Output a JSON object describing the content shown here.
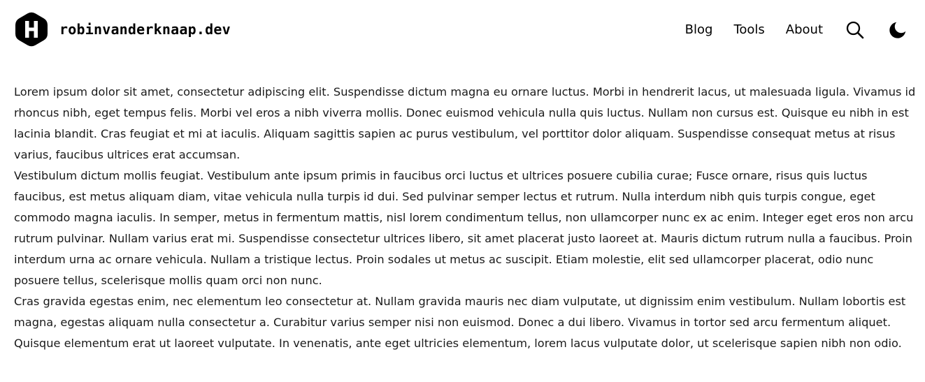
{
  "header": {
    "site_name": "robinvanderknaap.dev",
    "logo_icon": "hexagon-h-logo-icon",
    "nav": [
      {
        "label": "Blog"
      },
      {
        "label": "Tools"
      },
      {
        "label": "About"
      }
    ],
    "search_icon": "search-icon",
    "theme_toggle_icon": "moon-icon"
  },
  "content": {
    "paragraphs": [
      "Lorem ipsum dolor sit amet, consectetur adipiscing elit. Suspendisse dictum magna eu ornare luctus. Morbi in hendrerit lacus, ut malesuada ligula. Vivamus id rhoncus nibh, eget tempus felis. Morbi vel eros a nibh viverra mollis. Donec euismod vehicula nulla quis luctus. Nullam non cursus est. Quisque eu nibh in est lacinia blandit. Cras feugiat et mi at iaculis. Aliquam sagittis sapien ac purus vestibulum, vel porttitor dolor aliquam. Suspendisse consequat metus at risus varius, faucibus ultrices erat accumsan.",
      "Vestibulum dictum mollis feugiat. Vestibulum ante ipsum primis in faucibus orci luctus et ultrices posuere cubilia curae; Fusce ornare, risus quis luctus faucibus, est metus aliquam diam, vitae vehicula nulla turpis id dui. Sed pulvinar semper lectus et rutrum. Nulla interdum nibh quis turpis congue, eget commodo magna iaculis. In semper, metus in fermentum mattis, nisl lorem condimentum tellus, non ullamcorper nunc ex ac enim. Integer eget eros non arcu rutrum pulvinar. Nullam varius erat mi. Suspendisse consectetur ultrices libero, sit amet placerat justo laoreet at. Mauris dictum rutrum nulla a faucibus. Proin interdum urna ac ornare vehicula. Nullam a tristique lectus. Proin sodales ut metus ac suscipit. Etiam molestie, elit sed ullamcorper placerat, odio nunc posuere tellus, scelerisque mollis quam orci non nunc.",
      "Cras gravida egestas enim, nec elementum leo consectetur at. Nullam gravida mauris nec diam vulputate, ut dignissim enim vestibulum. Nullam lobortis est magna, egestas aliquam nulla consectetur a. Curabitur varius semper nisi non euismod. Donec a dui libero. Vivamus in tortor sed arcu fermentum aliquet. Quisque elementum erat ut laoreet vulputate. In venenatis, ante eget ultricies elementum, lorem lacus vulputate dolor, ut scelerisque sapien nibh non odio."
    ]
  }
}
